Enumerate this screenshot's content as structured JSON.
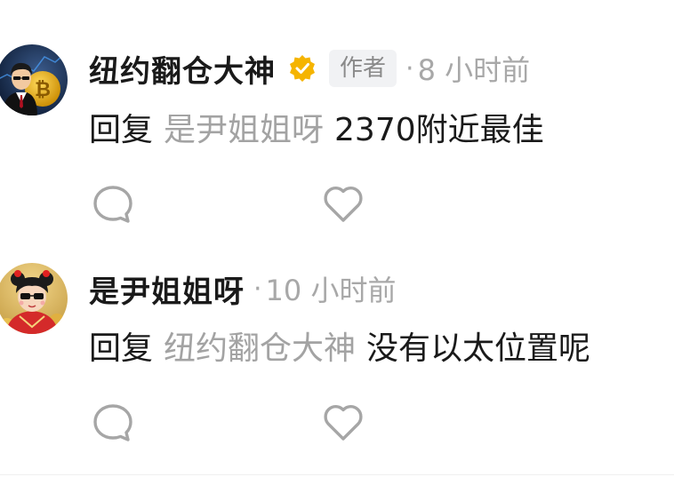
{
  "comments": [
    {
      "username": "纽约翻仓大神",
      "verified": true,
      "author_tag": "作者",
      "separator": "·",
      "timestamp": "8 小时前",
      "reply_prefix": "回复",
      "reply_to": "是尹姐姐呀",
      "text": "2370附近最佳",
      "avatar_icon": "bitcoin-businessman-avatar"
    },
    {
      "username": "是尹姐姐呀",
      "verified": false,
      "separator": "·",
      "timestamp": "10 小时前",
      "reply_prefix": "回复",
      "reply_to": "纽约翻仓大神",
      "text": "没有以太位置呢",
      "avatar_icon": "cartoon-girl-avatar"
    }
  ],
  "icons": {
    "comment": "comment-bubble-icon",
    "like": "heart-outline-icon",
    "verified": "verified-check-badge-icon"
  },
  "colors": {
    "primary_text": "#1a1a1a",
    "secondary_text": "#a3a3a3",
    "icon_gray": "#a6a6a6",
    "verified_gold": "#f5b400",
    "tag_background": "#f1f2f4"
  }
}
